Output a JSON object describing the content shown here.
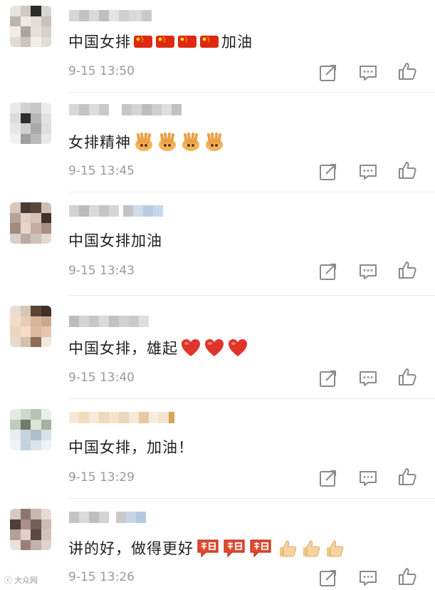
{
  "comments": [
    {
      "text_pre": "中国女排",
      "text_post": "加油",
      "emoji": "cn-flag-emoji",
      "emoji_count": 4,
      "time": "9-15 13:50"
    },
    {
      "text_pre": "女排精神",
      "text_post": "",
      "emoji": "victory-hand-emoji",
      "emoji_count": 4,
      "time": "9-15 13:45"
    },
    {
      "text_pre": "中国女排加油",
      "text_post": "",
      "emoji": "",
      "emoji_count": 0,
      "time": "9-15 13:43"
    },
    {
      "text_pre": "中国女排，雄起",
      "text_post": "",
      "emoji": "heart-emoji",
      "emoji_count": 3,
      "time": "9-15 13:40"
    },
    {
      "text_pre": "中国女排，加油！",
      "text_post": "",
      "emoji": "",
      "emoji_count": 0,
      "time": "9-15 13:29"
    },
    {
      "text_pre": "讲的好，做得更好",
      "text_post": "",
      "emoji": "fighting-sticker-emoji",
      "emoji_count": 3,
      "emoji2": "thumbs-up-emoji",
      "emoji2_count": 3,
      "time": "9-15 13:26"
    }
  ],
  "actions": [
    "share-icon",
    "reply-icon",
    "like-icon"
  ],
  "colors": {
    "text": "#1f1f1f",
    "time": "#9a9a9a",
    "icon": "#8a8a8a",
    "flag_red": "#de2910",
    "flag_yellow": "#ffde00",
    "heart": "#e0342b"
  },
  "watermark": "大众网"
}
